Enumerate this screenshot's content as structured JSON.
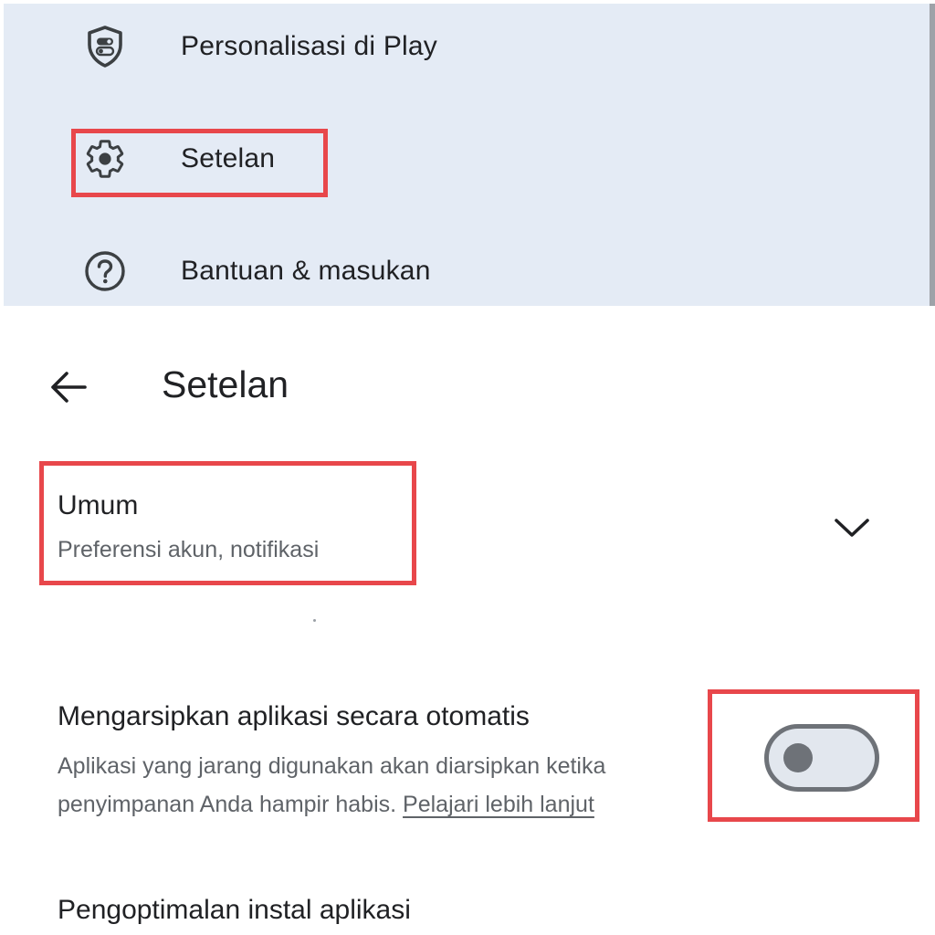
{
  "menu": {
    "items": [
      {
        "label": "Personalisasi di Play",
        "icon": "shield-toggle-icon"
      },
      {
        "label": "Setelan",
        "icon": "gear-icon"
      },
      {
        "label": "Bantuan & masukan",
        "icon": "help-circle-icon"
      }
    ]
  },
  "settings": {
    "title": "Setelan",
    "back_icon": "arrow-back-icon",
    "general": {
      "title": "Umum",
      "subtitle": "Preferensi akun, notifikasi",
      "expand_icon": "chevron-down-icon"
    },
    "auto_archive": {
      "title": "Mengarsipkan aplikasi secara otomatis",
      "description": "Aplikasi yang jarang digunakan akan diarsipkan ketika penyimpanan Anda hampir habis.",
      "learn_more": "Pelajari lebih lanjut",
      "toggle_state": "off"
    },
    "install_optimization": {
      "title": "Pengoptimalan instal aplikasi"
    }
  },
  "colors": {
    "menu_background": "#e4ebf5",
    "highlight": "#e8474b",
    "toggle_outline": "#6e7278",
    "toggle_track": "#e2e7ee"
  }
}
